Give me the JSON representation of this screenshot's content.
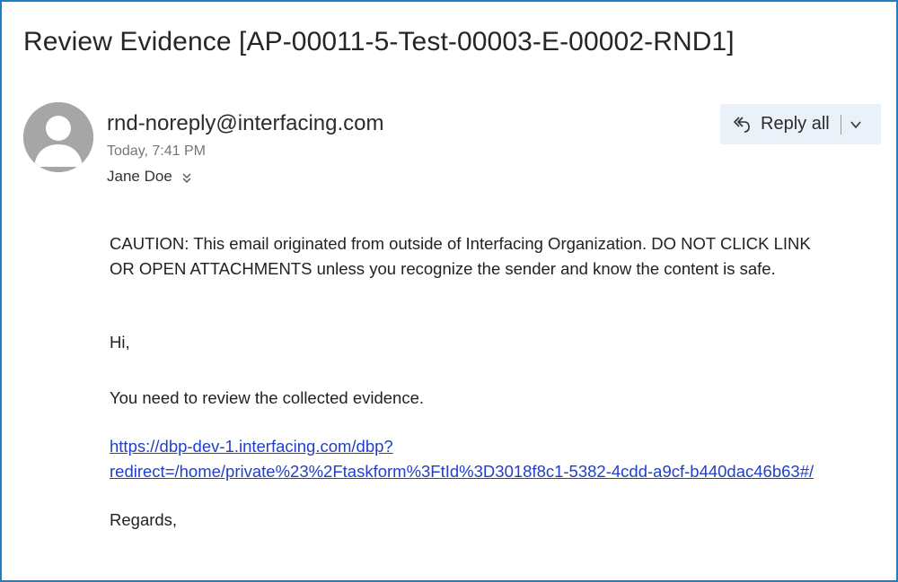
{
  "email": {
    "subject": "Review Evidence [AP-00011-5-Test-00003-E-00002-RND1]",
    "sender": "rnd-noreply@interfacing.com",
    "time": "Today, 7:41 PM",
    "recipient": "Jane Doe",
    "reply_all_label": "Reply all",
    "body": {
      "caution_line1": "CAUTION: This email originated from outside of Interfacing Organization. DO NOT CLICK LINK",
      "caution_line2": "OR OPEN ATTACHMENTS unless you recognize the sender and know the content is safe.",
      "greeting": "Hi,",
      "message": "You need to review the collected evidence.",
      "link_line1": "https://dbp-dev-1.interfacing.com/dbp?",
      "link_line2": "redirect=/home/private%23%2Ftaskform%3FtId%3D3018f8c1-5382-4cdd-a9cf-b440dac46b63#/",
      "closing": "Regards,"
    }
  },
  "icons": {
    "avatar": "default-user-avatar",
    "reply_all": "reply-all-icon",
    "dropdown": "chevron-down-icon",
    "expand_recipients": "double-chevron-down-icon"
  },
  "colors": {
    "frame_border": "#1e7fc4",
    "link": "#2140c8",
    "reply_button_bg": "#eaf1f8",
    "avatar_bg": "#a6a6a6"
  }
}
